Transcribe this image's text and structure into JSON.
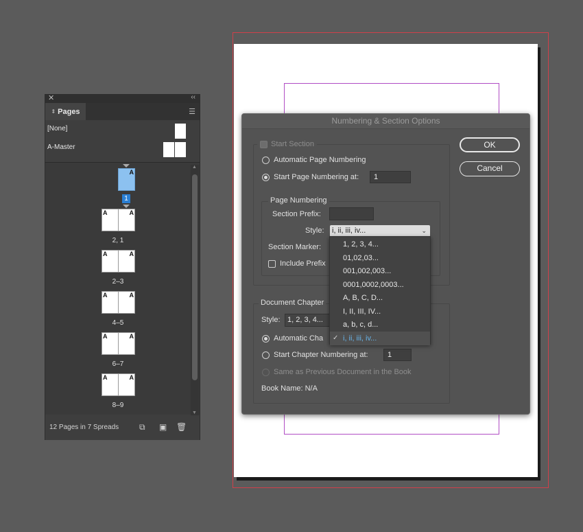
{
  "pages_panel": {
    "tab_label": "Pages",
    "masters": [
      {
        "label": "[None]"
      },
      {
        "label": "A-Master"
      }
    ],
    "page1": {
      "master_letter": "A",
      "number_badge": "1"
    },
    "spreads": [
      {
        "label": "2, 1",
        "left": "A",
        "right": "A"
      },
      {
        "label": "2–3",
        "left": "A",
        "right": "A"
      },
      {
        "label": "4–5",
        "left": "A",
        "right": "A"
      },
      {
        "label": "6–7",
        "left": "A",
        "right": "A"
      },
      {
        "label": "8–9",
        "left": "A",
        "right": "A"
      }
    ],
    "footer_text": "12 Pages in 7 Spreads",
    "icons": [
      "close-icon",
      "collapse-icon",
      "panel-menu-icon",
      "page-size-icon",
      "new-page-icon",
      "trash-icon"
    ]
  },
  "dialog": {
    "title": "Numbering & Section Options",
    "start_section": "Start Section",
    "auto_numbering": "Automatic Page Numbering",
    "start_numbering_at": "Start Page Numbering at:",
    "start_numbering_value": "1",
    "page_numbering_group": "Page Numbering",
    "section_prefix": "Section Prefix:",
    "section_prefix_value": "",
    "style_label": "Style:",
    "style_value": "i, ii, iii, iv...",
    "section_marker": "Section Marker:",
    "include_prefix": "Include Prefix",
    "style_options": [
      "1, 2, 3, 4...",
      "01,02,03...",
      "001,002,003...",
      "0001,0002,0003...",
      "A, B, C, D...",
      "I, II, III, IV...",
      "a, b, c, d...",
      "i, ii, iii, iv..."
    ],
    "style_selected_index": 7,
    "doc_chapter_group": "Document Chapter",
    "chapter_style_label": "Style:",
    "chapter_style_value": "1, 2, 3, 4...",
    "auto_chapter": "Automatic Cha",
    "start_chapter_at": "Start Chapter Numbering at:",
    "start_chapter_value": "1",
    "same_as_previous": "Same as Previous Document in the Book",
    "book_name": "Book Name: N/A",
    "ok": "OK",
    "cancel": "Cancel"
  },
  "colors": {
    "workspace": "#5b5b5b",
    "bleed": "#d0404a",
    "margin": "#b04cc4",
    "selected_page": "#8cc1f0",
    "dropdown_selected_text": "#67b2e6"
  }
}
